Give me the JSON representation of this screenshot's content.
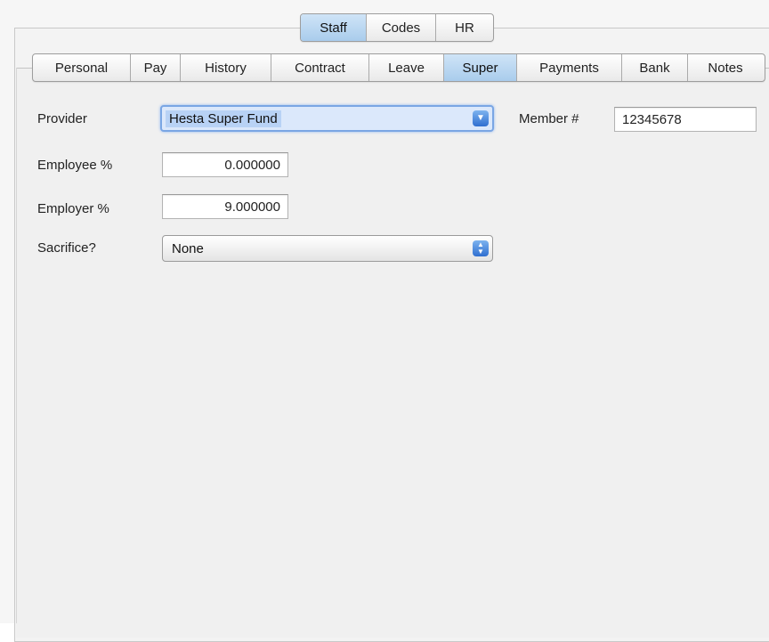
{
  "top_tabs": [
    {
      "label": "Staff",
      "selected": true
    },
    {
      "label": "Codes",
      "selected": false
    },
    {
      "label": "HR",
      "selected": false
    }
  ],
  "sub_tabs": [
    {
      "label": "Personal",
      "selected": false
    },
    {
      "label": "Pay",
      "selected": false
    },
    {
      "label": "History",
      "selected": false
    },
    {
      "label": "Contract",
      "selected": false
    },
    {
      "label": "Leave",
      "selected": false
    },
    {
      "label": "Super",
      "selected": true
    },
    {
      "label": "Payments",
      "selected": false
    },
    {
      "label": "Bank",
      "selected": false
    },
    {
      "label": "Notes",
      "selected": false
    }
  ],
  "form": {
    "provider_label": "Provider",
    "provider_value": "Hesta Super Fund",
    "member_label": "Member #",
    "member_value": "12345678",
    "employee_label": "Employee %",
    "employee_value": "0.000000",
    "employer_label": "Employer %",
    "employer_value": "9.000000",
    "sacrifice_label": "Sacrifice?",
    "sacrifice_value": "None"
  },
  "colors": {
    "selected_tab": "#a9ccec",
    "focus_ring": "#7aa6e4",
    "popup_button": "#2f6fd0"
  },
  "icons": {
    "provider_dropdown": "chevron-down-icon",
    "sacrifice_popup": "up-down-arrows-icon"
  }
}
